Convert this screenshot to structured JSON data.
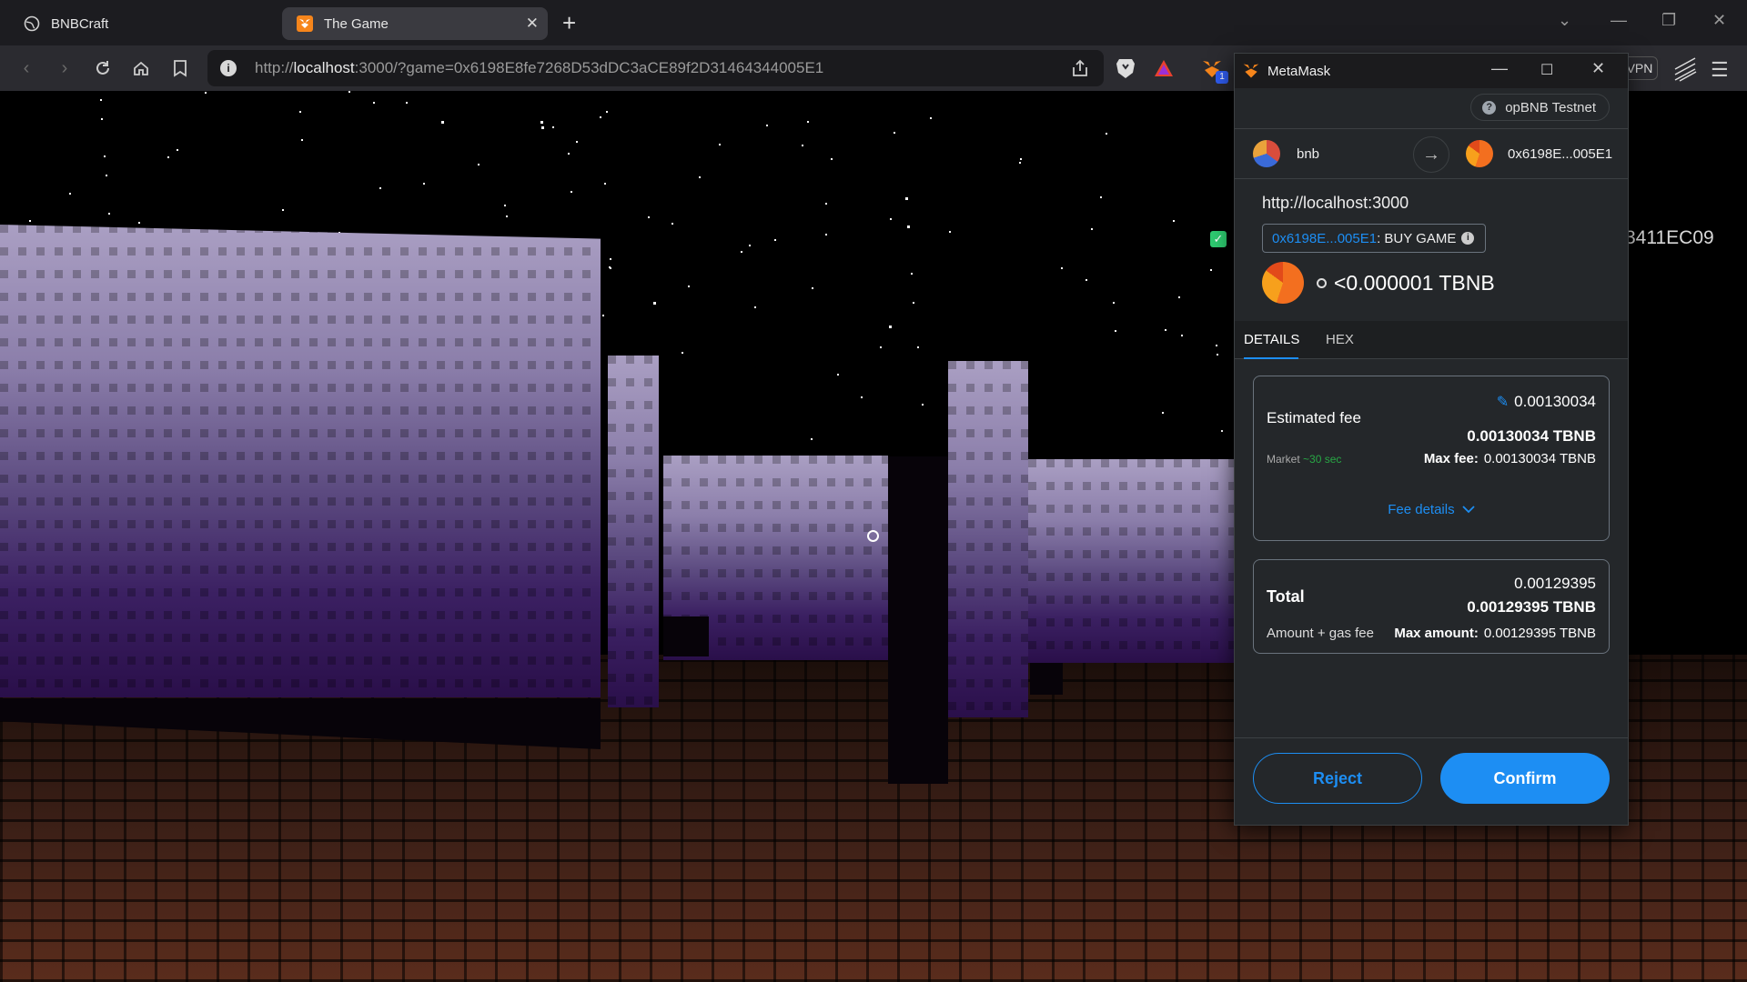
{
  "browser": {
    "tabs": [
      {
        "title": "BNBCraft",
        "icon": "globe-icon",
        "active": false
      },
      {
        "title": "The Game",
        "icon": "fox-icon",
        "active": true
      }
    ],
    "close_glyph": "✕",
    "newtab_glyph": "+",
    "url_host_prefix": "http://",
    "url_host": "localhost",
    "url_rest": ":3000/?game=0x6198E8fe7268D53dDC3aCE89f2D31464344005E1",
    "vpn_label": "VPN",
    "extension_badge": "1"
  },
  "game": {
    "address_partial": "3411EC09",
    "check_glyph": "✓"
  },
  "metamask": {
    "title": "MetaMask",
    "network": "opBNB Testnet",
    "from_account": "bnb",
    "to_account": "0x6198E...005E1",
    "origin": "http://localhost:3000",
    "method_address": "0x6198E...005E1",
    "method_name": " : BUY GAME",
    "value_amount": "<0.000001 TBNB",
    "tabs": {
      "details": "DETAILS",
      "hex": "HEX"
    },
    "fee": {
      "label": "Estimated fee",
      "amount": "0.00130034",
      "amount_tbnb": "0.00130034 TBNB",
      "market": "Market",
      "market_time": "~30 sec",
      "max_fee_label": "Max fee:",
      "max_fee_value": "0.00130034 TBNB",
      "details_link": "Fee details"
    },
    "total": {
      "label": "Total",
      "amount": "0.00129395",
      "amount_tbnb": "0.00129395 TBNB",
      "sub_label": "Amount + gas fee",
      "max_label": "Max amount:",
      "max_value": "0.00129395 TBNB"
    },
    "buttons": {
      "reject": "Reject",
      "confirm": "Confirm"
    }
  }
}
